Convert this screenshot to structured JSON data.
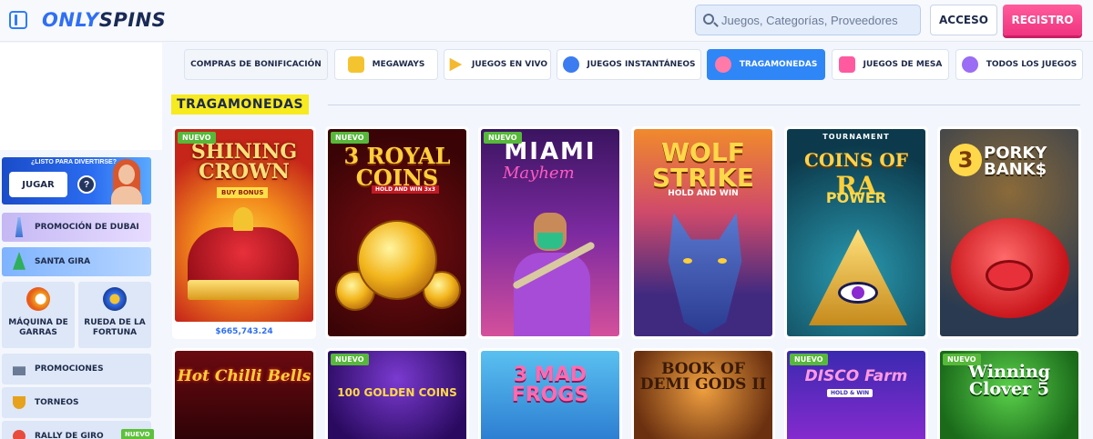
{
  "header": {
    "logo_text_a": "ONLY",
    "logo_text_b": "SPINS",
    "search_placeholder": "Juegos, Categorías, Proveedores",
    "login_label": "ACCESO",
    "register_label": "REGISTRO",
    "accent_color": "#2f6ff3",
    "register_color": "#f0347f"
  },
  "sidebar": {
    "promo_banner": {
      "ask_text": "¿LISTO PARA DIVERTIRSE?",
      "play_label": "JUGAR",
      "help_label": "?"
    },
    "cards": [
      {
        "label": "PROMOCIÓN DE DUBAI"
      },
      {
        "label": "SANTA GIRA"
      }
    ],
    "tiles": [
      {
        "label": "MÁQUINA DE GARRAS"
      },
      {
        "label": "RUEDA DE LA FORTUNA"
      }
    ],
    "menu": [
      {
        "label": "PROMOCIONES",
        "icon": "gift-icon"
      },
      {
        "label": "TORNEOS",
        "icon": "trophy-icon"
      },
      {
        "label": "RALLY DE GIRO",
        "icon": "rally-icon",
        "badge": "NUEVO"
      }
    ]
  },
  "categories": [
    {
      "label": "COMPRAS DE BONIFICACIÓN"
    },
    {
      "label": "MEGAWAYS"
    },
    {
      "label": "JUEGOS EN VIVO"
    },
    {
      "label": "JUEGOS INSTANTÁNEOS"
    },
    {
      "label": "TRAGAMONEDAS",
      "active": true
    },
    {
      "label": "JUEGOS DE MESA"
    },
    {
      "label": "TODOS LOS JUEGOS"
    }
  ],
  "section": {
    "title": "TRAGAMONEDAS"
  },
  "games": [
    {
      "title": "SHINING CROWN",
      "subtitle": "BUY BONUS",
      "badge": "NUEVO",
      "jackpot": "$665,743.24"
    },
    {
      "title": "3 ROYAL COINS",
      "subtitle": "HOLD AND WIN 3x3",
      "badge": "NUEVO"
    },
    {
      "title": "MIAMI",
      "subtitle": "Mayhem",
      "badge": "NUEVO"
    },
    {
      "title": "WOLF STRIKE",
      "subtitle": "HOLD AND WIN"
    },
    {
      "title": "COINS OF",
      "subtitle": "RA",
      "extra": "POWER",
      "tag": "TOURNAMENT"
    },
    {
      "title": "PORKY BANK$",
      "number": "3"
    },
    {
      "title": "Hot Chilli Bells"
    },
    {
      "title": "100 GOLDEN COINS",
      "badge": "NUEVO"
    },
    {
      "title": "3 MAD FROGS"
    },
    {
      "title": "BOOK OF DEMI GODS II"
    },
    {
      "title": "DISCO Farm",
      "subtitle": "HOLD & WIN",
      "badge": "NUEVO"
    },
    {
      "title": "Winning Clover 5",
      "badge": "NUEVO"
    }
  ]
}
